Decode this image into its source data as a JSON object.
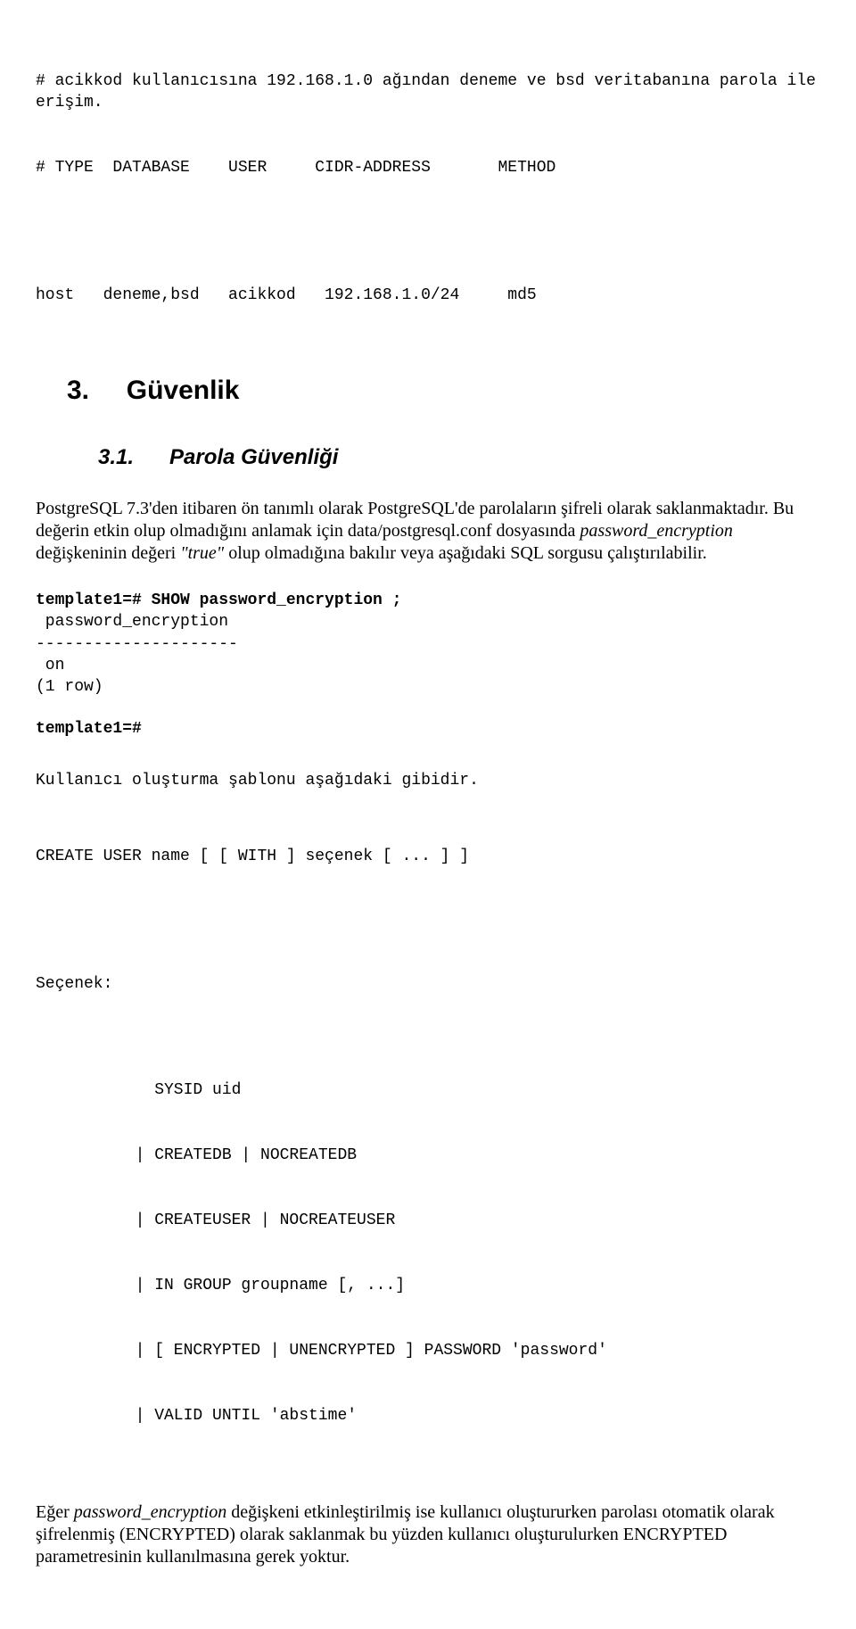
{
  "code1": {
    "line1": "# acikkod kullanıcısına 192.168.1.0 ağından deneme ve bsd veritabanına parola ile erişim.",
    "line2": "# TYPE  DATABASE    USER     CIDR-ADDRESS       METHOD",
    "line3": "host   deneme,bsd   acikkod   192.168.1.0/24     md5"
  },
  "section": {
    "number": "3.",
    "title": "Güvenlik"
  },
  "subsection": {
    "number": "3.1.",
    "title": "Parola Güvenliği"
  },
  "para1": {
    "s1a": "PostgreSQL 7.3'den itibaren ön tanımlı olarak PostgreSQL'de parolaların şifreli olarak saklanmaktadır. Bu değerin etkin olup olmadığını anlamak için data/postgresql.conf dosyasında ",
    "s1b": "password_encryption",
    "s1c": " değişkeninin değeri ",
    "s1d": "\"true\"",
    "s1e": " olup olmadığına bakılır veya aşağıdaki SQL sorgusu çalıştırılabilir."
  },
  "code2": {
    "l1": "template1=# SHOW password_encryption ;",
    "l2": " password_encryption",
    "l3": "---------------------",
    "l4": " on",
    "l5": "(1 row)",
    "l6": "template1=#"
  },
  "para2": "Kullanıcı oluşturma şablonu aşağıdaki gibidir.",
  "code3": {
    "l1": "CREATE USER name [ [ WITH ] seçenek [ ... ] ]",
    "l2": "Seçenek:"
  },
  "code4": {
    "l1": "    SYSID uid",
    "l2": "  | CREATEDB | NOCREATEDB",
    "l3": "  | CREATEUSER | NOCREATEUSER",
    "l4": "  | IN GROUP groupname [, ...]",
    "l5": "  | [ ENCRYPTED | UNENCRYPTED ] PASSWORD 'password'",
    "l6": "  | VALID UNTIL 'abstime'"
  },
  "para3": {
    "a": "Eğer ",
    "b": "password_encryption",
    "c": " değişkeni etkinleştirilmiş ise kullanıcı oluştururken parolası otomatik olarak şifrelenmiş (ENCRYPTED) olarak saklanmak bu yüzden kullanıcı oluşturulurken ENCRYPTED parametresinin kullanılmasına gerek yoktur."
  }
}
